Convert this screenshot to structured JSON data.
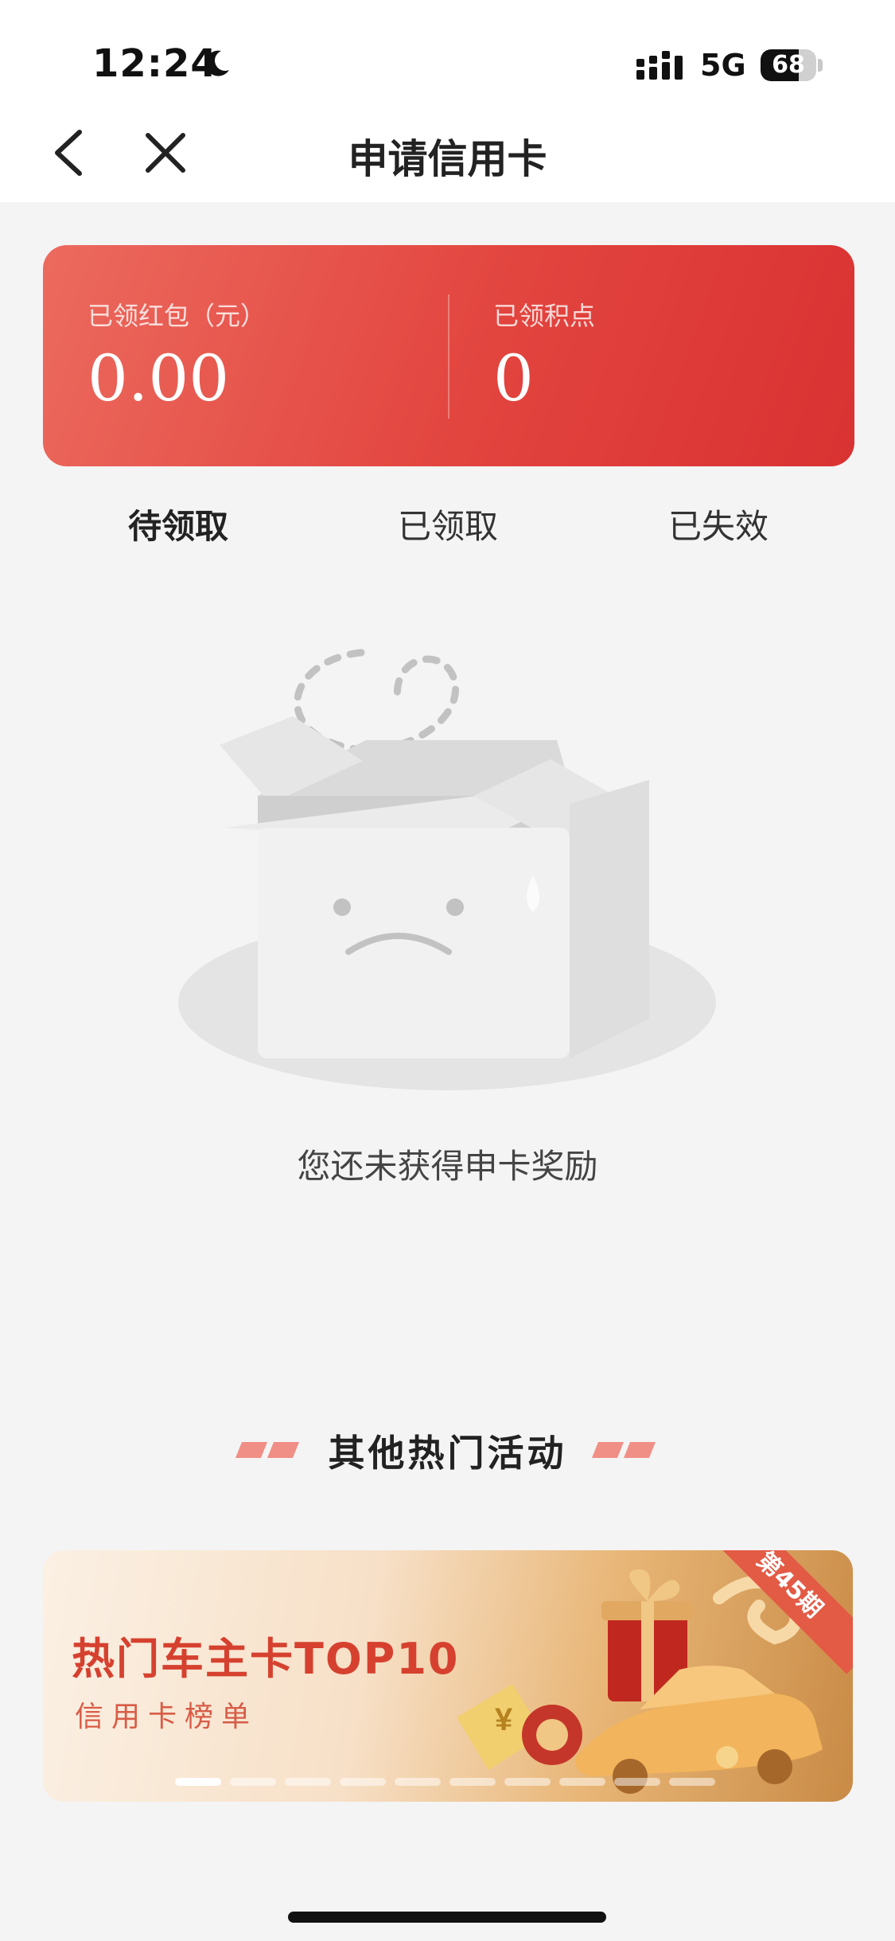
{
  "status_bar": {
    "time": "12:24",
    "network": "5G",
    "battery": "68",
    "battery_level": 0.68
  },
  "nav": {
    "title": "申请信用卡"
  },
  "summary": {
    "red_packet_label": "已领红包（元）",
    "red_packet_value": "0.00",
    "points_label": "已领积点",
    "points_value": "0"
  },
  "tabs": [
    {
      "label": "待领取",
      "active": true
    },
    {
      "label": "已领取",
      "active": false
    },
    {
      "label": "已失效",
      "active": false
    }
  ],
  "empty_state": {
    "message": "您还未获得申卡奖励"
  },
  "section": {
    "title": "其他热门活动"
  },
  "banner": {
    "title": "热门车主卡TOP10",
    "subtitle": "信用卡榜单",
    "ribbon": "第45期",
    "dot_count": 10,
    "active_dot": 0
  },
  "colors": {
    "accent_red": "#e2443e",
    "page_bg": "#f4f4f4",
    "banner_title": "#d6412f"
  }
}
